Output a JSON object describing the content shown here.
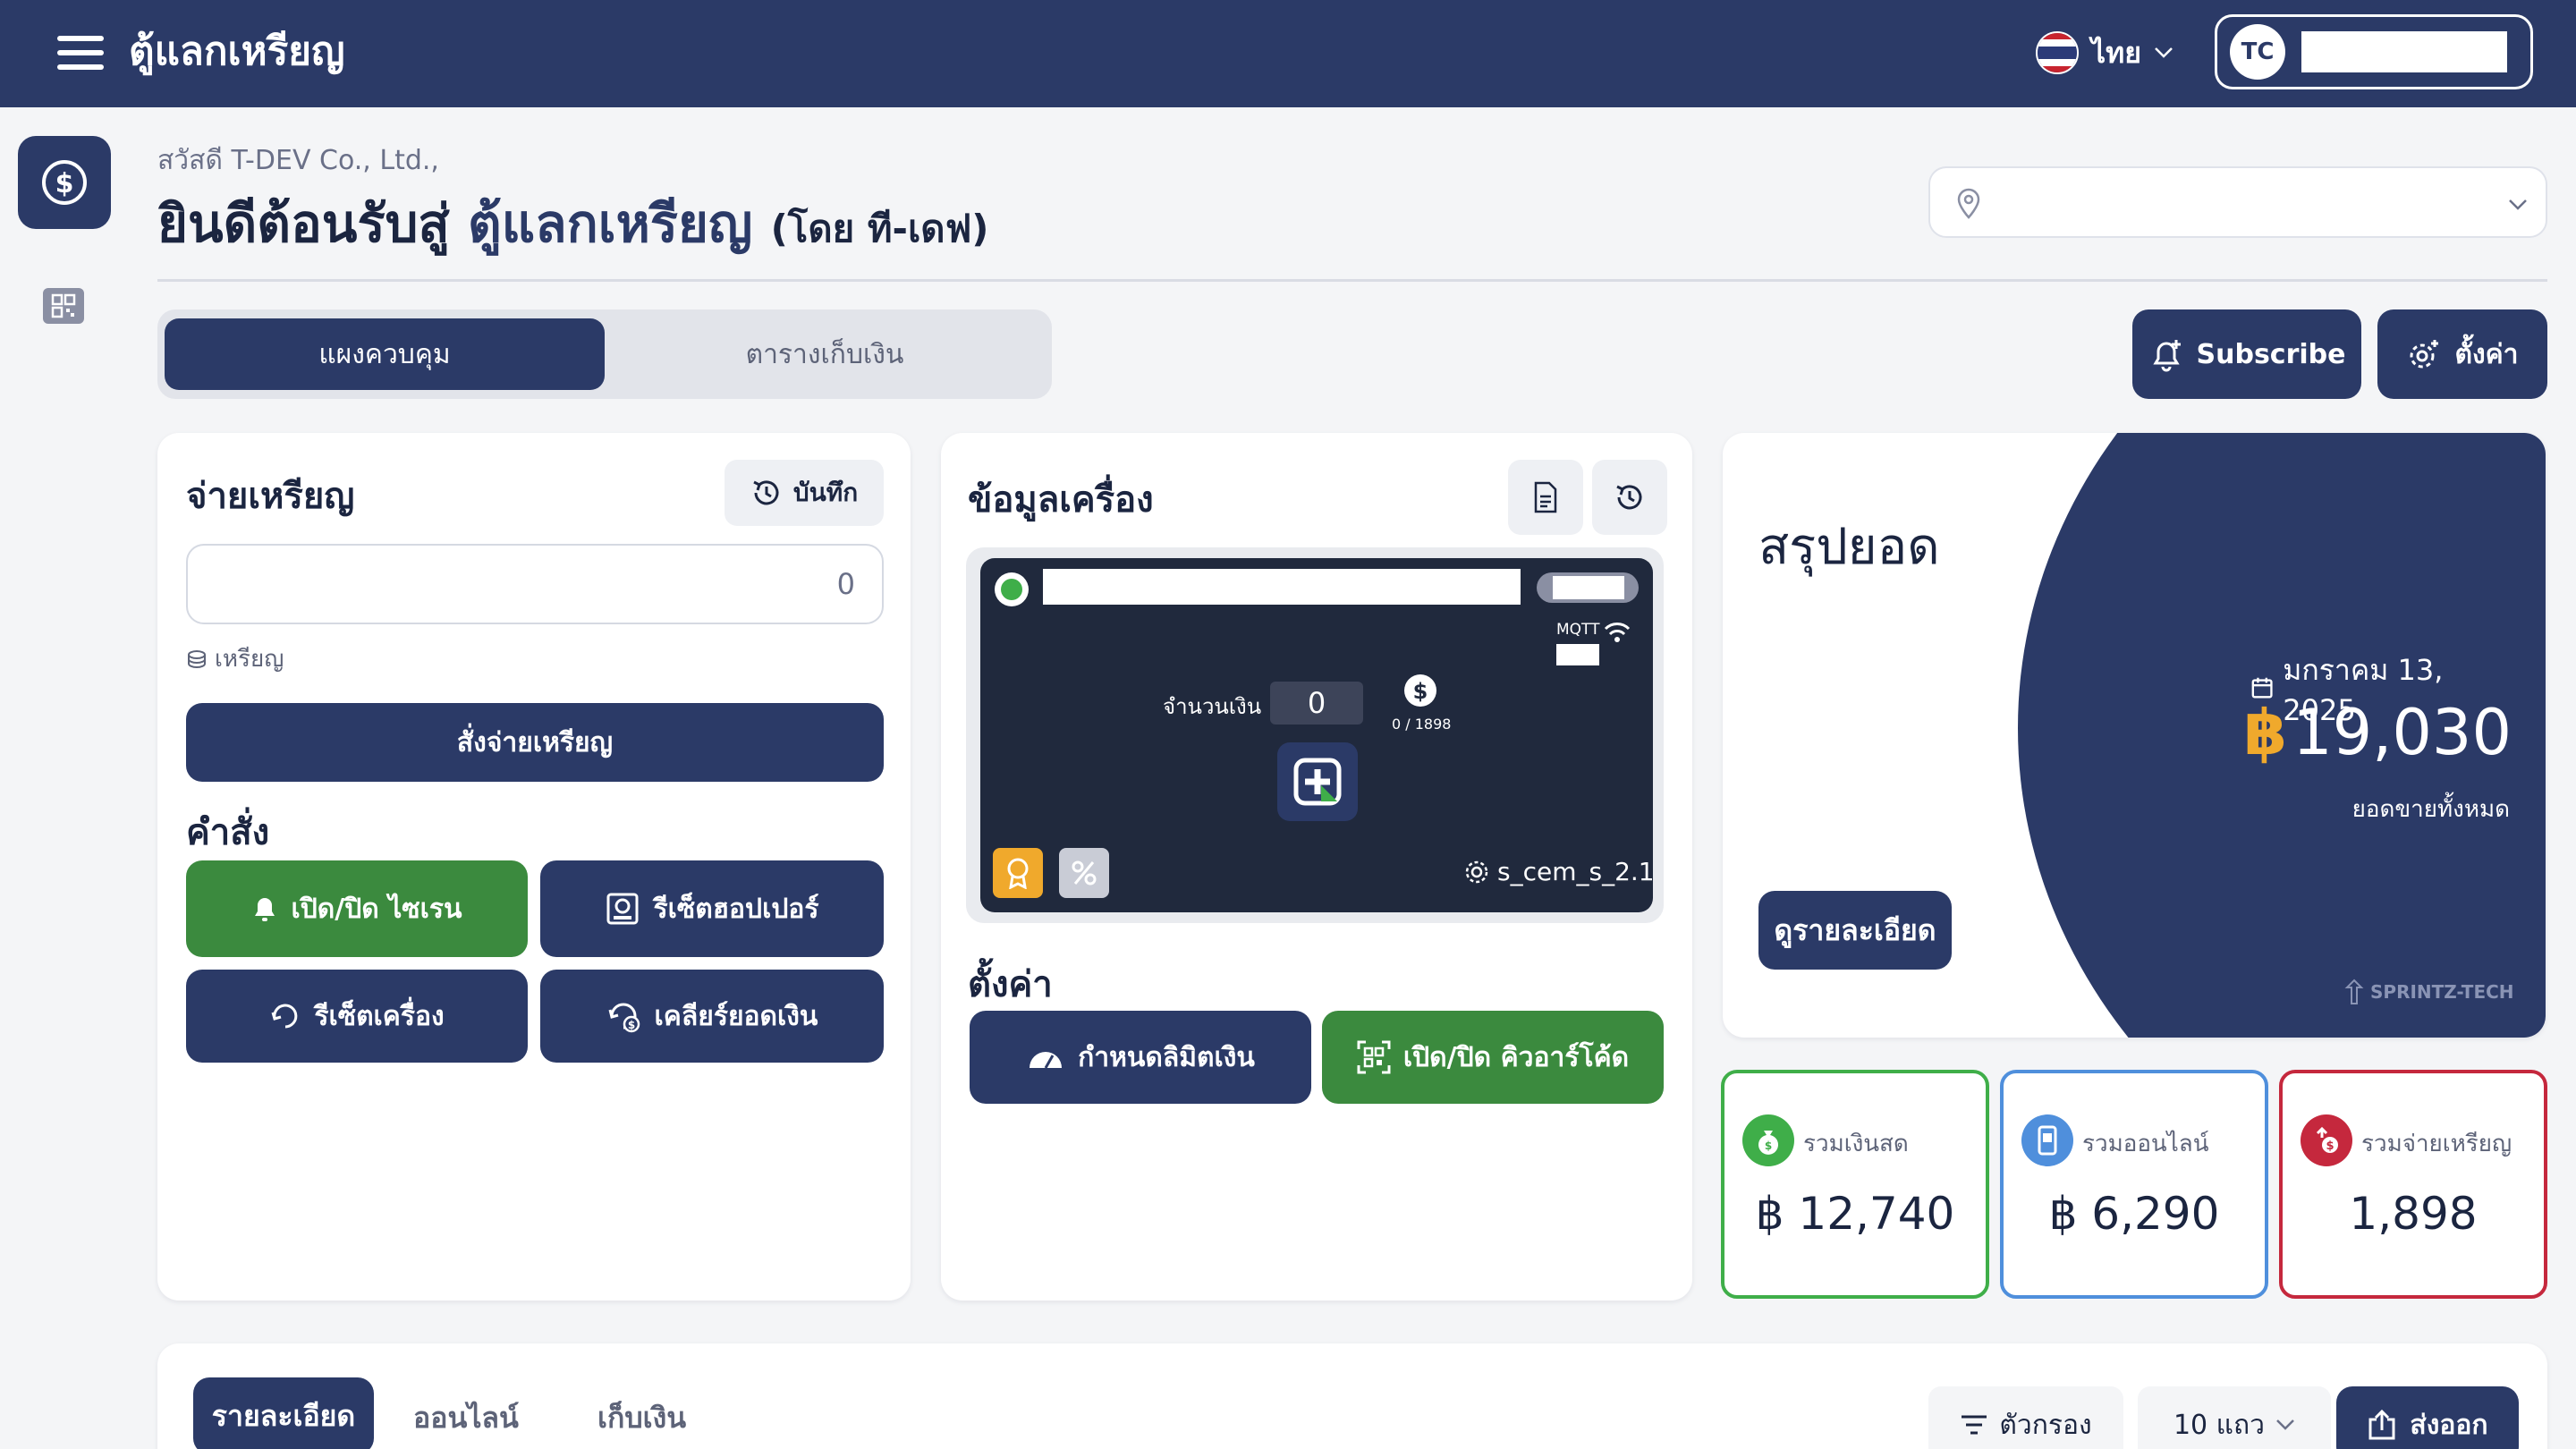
{
  "header": {
    "title": "ตู้แลกเหรียญ",
    "language": "ไทย",
    "avatar_initials": "TC"
  },
  "page": {
    "greeting": "สวัสดี T-DEV Co., Ltd.,",
    "welcome_prefix": "ยินดีต้อนรับสู่",
    "welcome_brand": "ตู้แลกเหรียญ",
    "welcome_suffix": "(โดย ที-เดฟ)"
  },
  "tabs": [
    {
      "label": "แผงควบคุม",
      "active": true
    },
    {
      "label": "ตารางเก็บเงิน",
      "active": false
    }
  ],
  "actions": {
    "subscribe": "Subscribe",
    "settings": "ตั้งค่า"
  },
  "coin_card": {
    "title": "จ่ายเหรียญ",
    "history_button": "บันทึก",
    "input_value": "0",
    "unit": "เหรียญ",
    "dispense_button": "สั่งจ่ายเหรียญ",
    "commands_title": "คำสั่ง",
    "commands": {
      "siren": "เปิด/ปิด ไซเรน",
      "reset_hopper": "รีเซ็ตฮอปเปอร์",
      "reset_machine": "รีเซ็ตเครื่อง",
      "clear_balance": "เคลียร์ยอดเงิน"
    }
  },
  "machine_card": {
    "title": "ข้อมูลเครื่อง",
    "protocol": "MQTT",
    "amount_label": "จำนวนเงิน",
    "amount_value": "0",
    "coin_count": "0 / 1898",
    "firmware": "s_cem_s_2.1",
    "settings_title": "ตั้งค่า",
    "limit_button": "กำหนดลิมิตเงิน",
    "qr_button": "เปิด/ปิด คิวอาร์โค้ด"
  },
  "summary": {
    "title": "สรุปยอด",
    "date": "มกราคม 13, 2025",
    "currency": "฿",
    "total": "19,030",
    "total_label": "ยอดขายทั้งหมด",
    "details_button": "ดูรายละเอียด",
    "watermark": "SPRINTZ-TECH"
  },
  "stats": [
    {
      "label": "รวมเงินสด",
      "value": "฿ 12,740",
      "color": "#3fae49"
    },
    {
      "label": "รวมออนไลน์",
      "value": "฿ 6,290",
      "color": "#4f8fdc"
    },
    {
      "label": "รวมจ่ายเหรียญ",
      "value": "1,898",
      "color": "#c5283d"
    }
  ],
  "bottom": {
    "tabs": [
      "รายละเอียด",
      "ออนไลน์",
      "เก็บเงิน"
    ],
    "filter": "ตัวกรอง",
    "rows": "10 แถว",
    "export": "ส่งออก"
  },
  "colors": {
    "primary": "#2b3a67",
    "green": "#3b8a3e",
    "gold": "#f0a92c"
  }
}
